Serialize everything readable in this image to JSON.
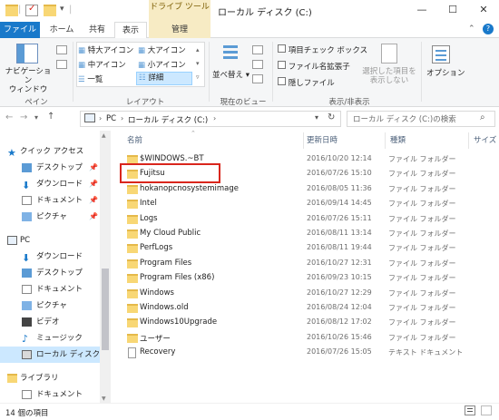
{
  "window": {
    "contextual_tab_group": "ドライブ ツール",
    "title": "ローカル ディスク (C:)",
    "minimize": "—",
    "maximize": "☐",
    "close": "✕"
  },
  "tabs": [
    {
      "label": "ファイル"
    },
    {
      "label": "ホーム"
    },
    {
      "label": "共有"
    },
    {
      "label": "表示"
    },
    {
      "label": "管理"
    }
  ],
  "ribbon": {
    "pane_group": {
      "navigation_pane": "ナビゲーション\nウィンドウ",
      "label": "ペイン"
    },
    "layout_group": {
      "options": [
        "特大アイコン",
        "大アイコン",
        "中アイコン",
        "小アイコン",
        "一覧",
        "詳細"
      ],
      "selected": "詳細",
      "label": "レイアウト"
    },
    "current_view_group": {
      "sort": "並べ替え",
      "label": "現在のビュー"
    },
    "show_hide_group": {
      "checkboxes": [
        "項目チェック ボックス",
        "ファイル名拡張子",
        "隠しファイル"
      ],
      "hide_selected": "選択した項目を\n表示しない",
      "label": "表示/非表示"
    },
    "options": "オプション"
  },
  "address": {
    "path": [
      "PC",
      "ローカル ディスク (C:)"
    ],
    "search_placeholder": "ローカル ディスク (C:)の検索"
  },
  "nav": {
    "quick_access": "クイック アクセス",
    "quick_items": [
      "デスクトップ",
      "ダウンロード",
      "ドキュメント",
      "ピクチャ"
    ],
    "pc": "PC",
    "pc_items": [
      "ダウンロード",
      "デスクトップ",
      "ドキュメント",
      "ピクチャ",
      "ビデオ",
      "ミュージック",
      "ローカル ディスク (C"
    ],
    "library": "ライブラリ",
    "library_items": [
      "ドキュメント"
    ]
  },
  "columns": {
    "name": "名前",
    "date": "更新日時",
    "type": "種類",
    "size": "サイズ"
  },
  "files": [
    {
      "name": "$WINDOWS.~BT",
      "date": "2016/10/20 12:14",
      "type": "ファイル フォルダー",
      "kind": "folder"
    },
    {
      "name": "Fujitsu",
      "date": "2016/07/26 15:10",
      "type": "ファイル フォルダー",
      "kind": "folder"
    },
    {
      "name": "hokanopcnosystemimage",
      "date": "2016/08/05 11:36",
      "type": "ファイル フォルダー",
      "kind": "folder"
    },
    {
      "name": "Intel",
      "date": "2016/09/14 14:45",
      "type": "ファイル フォルダー",
      "kind": "folder"
    },
    {
      "name": "Logs",
      "date": "2016/07/26 15:11",
      "type": "ファイル フォルダー",
      "kind": "folder"
    },
    {
      "name": "My Cloud Public",
      "date": "2016/08/11 13:14",
      "type": "ファイル フォルダー",
      "kind": "folder"
    },
    {
      "name": "PerfLogs",
      "date": "2016/08/11 19:44",
      "type": "ファイル フォルダー",
      "kind": "folder"
    },
    {
      "name": "Program Files",
      "date": "2016/10/27 12:31",
      "type": "ファイル フォルダー",
      "kind": "folder"
    },
    {
      "name": "Program Files (x86)",
      "date": "2016/09/23 10:15",
      "type": "ファイル フォルダー",
      "kind": "folder"
    },
    {
      "name": "Windows",
      "date": "2016/10/27 12:29",
      "type": "ファイル フォルダー",
      "kind": "folder"
    },
    {
      "name": "Windows.old",
      "date": "2016/08/24 12:04",
      "type": "ファイル フォルダー",
      "kind": "folder"
    },
    {
      "name": "Windows10Upgrade",
      "date": "2016/08/12 17:02",
      "type": "ファイル フォルダー",
      "kind": "folder"
    },
    {
      "name": "ユーザー",
      "date": "2016/10/26 15:46",
      "type": "ファイル フォルダー",
      "kind": "folder"
    },
    {
      "name": "Recovery",
      "date": "2016/07/26 15:05",
      "type": "テキスト ドキュメント",
      "kind": "text"
    }
  ],
  "status": "14 個の項目"
}
